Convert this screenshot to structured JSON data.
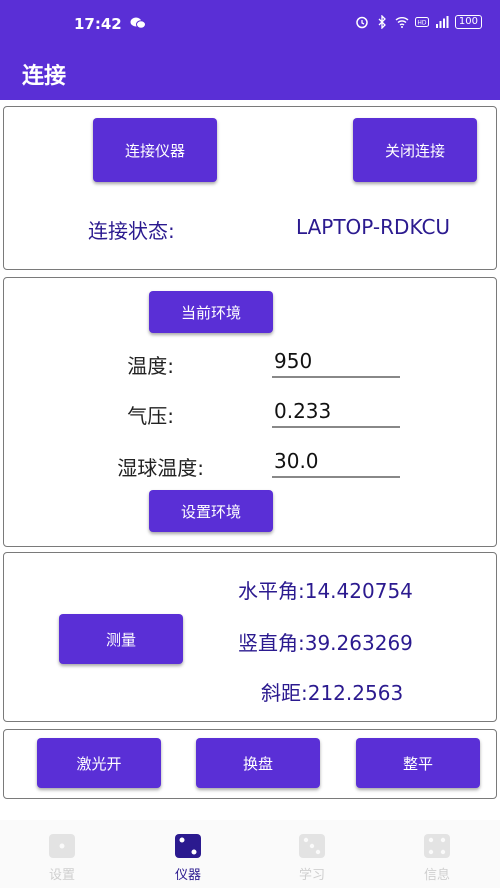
{
  "status_bar": {
    "time": "17:42",
    "battery": "100"
  },
  "app_bar": {
    "title": "连接"
  },
  "connection": {
    "connect_button": "连接仪器",
    "disconnect_button": "关闭连接",
    "status_label": "连接状态:",
    "status_value": "LAPTOP-RDKCU"
  },
  "environment": {
    "current_env_button": "当前环境",
    "temperature_label": "温度:",
    "temperature_value": "950",
    "pressure_label": "气压:",
    "pressure_value": "0.233",
    "wet_bulb_label": "湿球温度:",
    "wet_bulb_value": "30.0",
    "set_env_button": "设置环境"
  },
  "measurement": {
    "measure_button": "测量",
    "horizontal_angle": "水平角:14.420754",
    "vertical_angle": "竖直角:39.263269",
    "slope_distance": "斜距:212.2563"
  },
  "controls": {
    "laser_on_button": "激光开",
    "face_change_button": "换盘",
    "level_button": "整平"
  },
  "bottom_nav": {
    "items": [
      {
        "label": "设置",
        "icon": "dice-one-icon",
        "active": false
      },
      {
        "label": "仪器",
        "icon": "dice-two-icon",
        "active": true
      },
      {
        "label": "学习",
        "icon": "dice-three-icon",
        "active": false
      },
      {
        "label": "信息",
        "icon": "dice-four-icon",
        "active": false
      }
    ]
  },
  "colors": {
    "accent": "#5a2fd6",
    "text_blue": "#2b1a8f",
    "inactive": "#cfcfcf"
  }
}
